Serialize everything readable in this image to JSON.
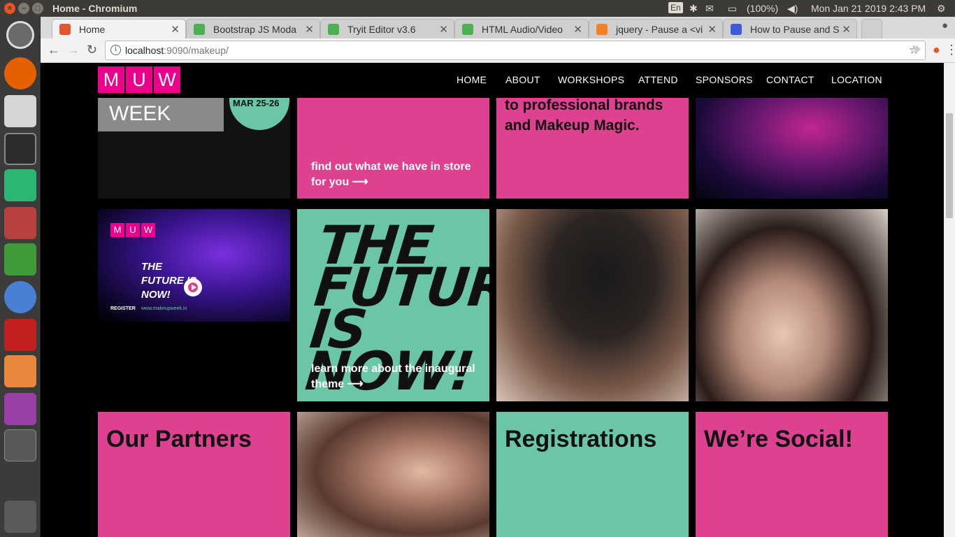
{
  "os": {
    "window_title": "Home - Chromium",
    "keyboard_layout": "En",
    "battery": "(100%)",
    "clock": "Mon Jan 21 2019  2:43 PM"
  },
  "browser": {
    "tabs": [
      {
        "label": "Home",
        "favicon_color": "#e4572e"
      },
      {
        "label": "Bootstrap JS Moda",
        "favicon_color": "#4caf50"
      },
      {
        "label": "Tryit Editor v3.6",
        "favicon_color": "#4caf50"
      },
      {
        "label": "HTML Audio/Video",
        "favicon_color": "#4caf50"
      },
      {
        "label": "jquery - Pause a <vi",
        "favicon_color": "#f48024"
      },
      {
        "label": "How to Pause and S",
        "favicon_color": "#3b5bdb"
      }
    ],
    "url_host": "localhost",
    "url_path": ":9090/makeup/"
  },
  "site": {
    "logo_letters": [
      "M",
      "U",
      "W"
    ],
    "nav": [
      "HOME",
      "ABOUT",
      "WORKSHOPS",
      "ATTEND",
      "SPONSORS",
      "CONTACT",
      "LOCATION"
    ],
    "tiles": {
      "makeup_week_text": "WEEK",
      "date_badge": "MAR 25-26",
      "store_link": "find out what we have in store for you ⟶",
      "brands_text": "to professional brands and Makeup Magic.",
      "video_future": "THE FUTURE IS NOW!",
      "video_register": "REGISTER",
      "video_url": "www.makeupweek.in",
      "future_headline": "THE FUTURE IS NOW!",
      "future_link": "learn more about the inaugural theme ⟶",
      "partners": "Our Partners",
      "registrations": "Registrations",
      "social": "We’re Social!"
    }
  },
  "colors": {
    "brand_pink": "#de4190",
    "logo_magenta": "#ec008c",
    "teal": "#6bc6a8"
  }
}
